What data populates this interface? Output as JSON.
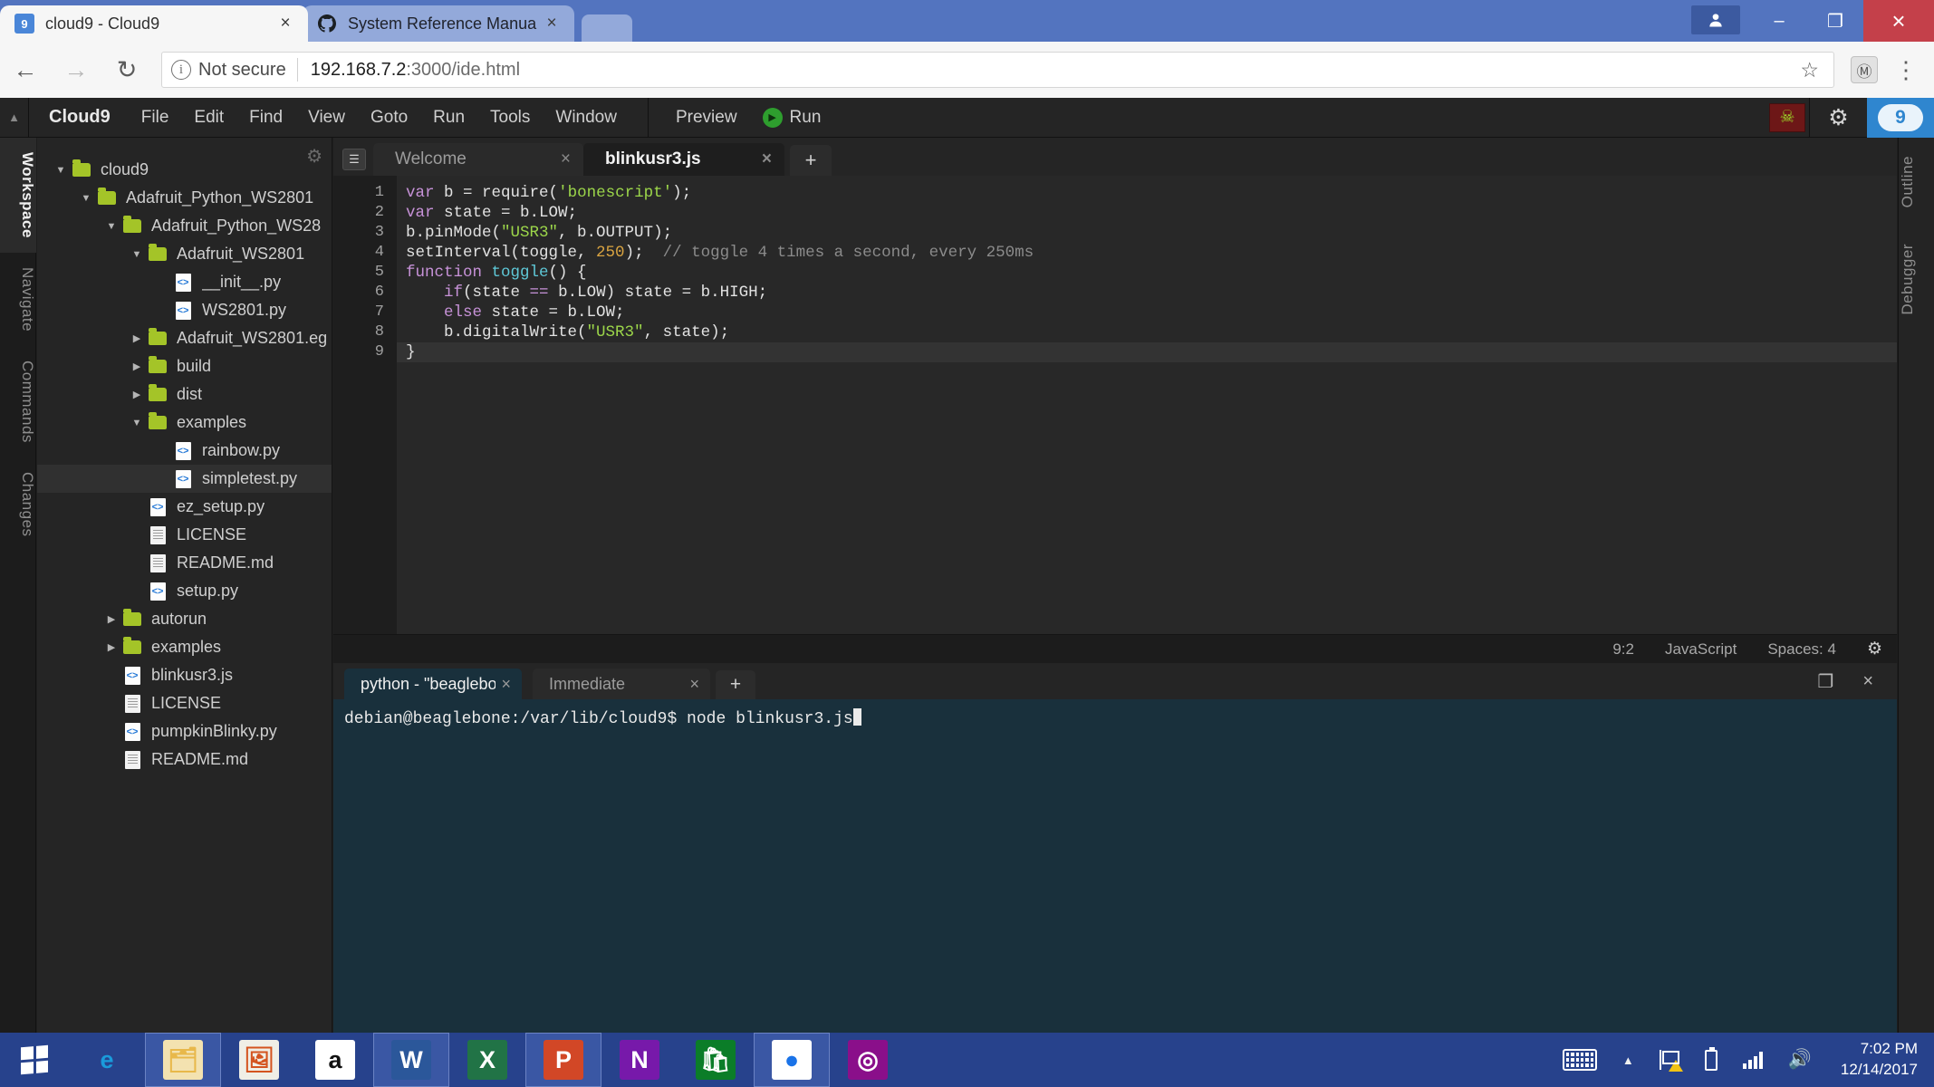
{
  "browser": {
    "tabs": [
      {
        "title": "cloud9 - Cloud9",
        "favicon": "cloud9-icon",
        "favicon_glyph": "9",
        "active": true,
        "close": "×"
      },
      {
        "title": "System Reference Manua",
        "favicon": "github-icon",
        "favicon_glyph": "●",
        "active": false,
        "close": "×"
      }
    ],
    "window_controls": {
      "profile": "👤",
      "minimize": "–",
      "restore": "❐",
      "close": "×"
    },
    "toolbar": {
      "back": "←",
      "forward": "→",
      "reload": "↻",
      "info_glyph": "i",
      "security_label": "Not secure",
      "url_host": "192.168.7.2",
      "url_rest": ":3000/ide.html",
      "bookmark": "☆",
      "extension_glyph": "Ⓜ",
      "menu": "⋮"
    }
  },
  "ide": {
    "menubar": {
      "collapse": "▲",
      "brand": "Cloud9",
      "items": [
        "File",
        "Edit",
        "Find",
        "View",
        "Goto",
        "Run",
        "Tools",
        "Window"
      ],
      "preview": "Preview",
      "run": "Run",
      "run_glyph": "▶",
      "bug_glyph": "☠",
      "gear_glyph": "⚙",
      "logo_glyph": "9"
    },
    "left_rail": [
      {
        "label": "Workspace",
        "active": true
      },
      {
        "label": "Navigate",
        "active": false
      },
      {
        "label": "Commands",
        "active": false
      },
      {
        "label": "Changes",
        "active": false
      }
    ],
    "right_rail": [
      {
        "label": "Outline"
      },
      {
        "label": "Debugger"
      }
    ],
    "filetree": {
      "gear": "⚙",
      "nodes": [
        {
          "label": "cloud9",
          "depth": 0,
          "type": "folder",
          "twist": "▼",
          "selected": false
        },
        {
          "label": "Adafruit_Python_WS2801",
          "depth": 1,
          "type": "folder",
          "twist": "▼",
          "selected": false
        },
        {
          "label": "Adafruit_Python_WS28",
          "depth": 2,
          "type": "folder",
          "twist": "▼",
          "selected": false
        },
        {
          "label": "Adafruit_WS2801",
          "depth": 3,
          "type": "folder",
          "twist": "▼",
          "selected": false
        },
        {
          "label": "__init__.py",
          "depth": 4,
          "type": "py",
          "twist": "",
          "selected": false
        },
        {
          "label": "WS2801.py",
          "depth": 4,
          "type": "py",
          "twist": "",
          "selected": false
        },
        {
          "label": "Adafruit_WS2801.eg",
          "depth": 3,
          "type": "folder",
          "twist": "▶",
          "selected": false
        },
        {
          "label": "build",
          "depth": 3,
          "type": "folder",
          "twist": "▶",
          "selected": false
        },
        {
          "label": "dist",
          "depth": 3,
          "type": "folder",
          "twist": "▶",
          "selected": false
        },
        {
          "label": "examples",
          "depth": 3,
          "type": "folder",
          "twist": "▼",
          "selected": false
        },
        {
          "label": "rainbow.py",
          "depth": 4,
          "type": "py",
          "twist": "",
          "selected": false
        },
        {
          "label": "simpletest.py",
          "depth": 4,
          "type": "py",
          "twist": "",
          "selected": true
        },
        {
          "label": "ez_setup.py",
          "depth": 3,
          "type": "py",
          "twist": "",
          "selected": false
        },
        {
          "label": "LICENSE",
          "depth": 3,
          "type": "doc",
          "twist": "",
          "selected": false
        },
        {
          "label": "README.md",
          "depth": 3,
          "type": "doc",
          "twist": "",
          "selected": false
        },
        {
          "label": "setup.py",
          "depth": 3,
          "type": "py",
          "twist": "",
          "selected": false
        },
        {
          "label": "autorun",
          "depth": 2,
          "type": "folder",
          "twist": "▶",
          "selected": false
        },
        {
          "label": "examples",
          "depth": 2,
          "type": "folder",
          "twist": "▶",
          "selected": false
        },
        {
          "label": "blinkusr3.js",
          "depth": 2,
          "type": "py",
          "twist": "",
          "selected": false
        },
        {
          "label": "LICENSE",
          "depth": 2,
          "type": "doc",
          "twist": "",
          "selected": false
        },
        {
          "label": "pumpkinBlinky.py",
          "depth": 2,
          "type": "py",
          "twist": "",
          "selected": false
        },
        {
          "label": "README.md",
          "depth": 2,
          "type": "doc",
          "twist": "",
          "selected": false
        }
      ]
    },
    "editor": {
      "tab_menu_glyph": "☰",
      "tabs": [
        {
          "label": "Welcome",
          "active": false,
          "close": "×"
        },
        {
          "label": "blinkusr3.js",
          "active": true,
          "close": "×"
        }
      ],
      "new_tab": "+",
      "line_numbers": [
        "1",
        "2",
        "3",
        "4",
        "5",
        "6",
        "7",
        "8",
        "9"
      ],
      "code_lines": [
        [
          {
            "t": "var ",
            "c": "k-kw"
          },
          {
            "t": "b = ",
            "c": "k-id"
          },
          {
            "t": "require",
            "c": "k-id"
          },
          {
            "t": "(",
            "c": "k-id"
          },
          {
            "t": "'bonescript'",
            "c": "k-str"
          },
          {
            "t": ");",
            "c": "k-id"
          }
        ],
        [
          {
            "t": "var ",
            "c": "k-kw"
          },
          {
            "t": "state = b.LOW;",
            "c": "k-id"
          }
        ],
        [
          {
            "t": "b.pinMode(",
            "c": "k-id"
          },
          {
            "t": "\"USR3\"",
            "c": "k-str"
          },
          {
            "t": ", b.OUTPUT);",
            "c": "k-id"
          }
        ],
        [
          {
            "t": "setInterval(toggle, ",
            "c": "k-id"
          },
          {
            "t": "250",
            "c": "k-num"
          },
          {
            "t": ");  ",
            "c": "k-id"
          },
          {
            "t": "// toggle 4 times a second, every 250ms",
            "c": "k-cmt"
          }
        ],
        [
          {
            "t": "function ",
            "c": "k-kw"
          },
          {
            "t": "toggle",
            "c": "k-fn"
          },
          {
            "t": "() {",
            "c": "k-id"
          }
        ],
        [
          {
            "t": "    ",
            "c": "k-id"
          },
          {
            "t": "if",
            "c": "k-kw"
          },
          {
            "t": "(state ",
            "c": "k-id"
          },
          {
            "t": "==",
            "c": "k-kw"
          },
          {
            "t": " b.LOW) state = b.HIGH;",
            "c": "k-id"
          }
        ],
        [
          {
            "t": "    ",
            "c": "k-id"
          },
          {
            "t": "else",
            "c": "k-kw"
          },
          {
            "t": " state = b.LOW;",
            "c": "k-id"
          }
        ],
        [
          {
            "t": "    b.digitalWrite(",
            "c": "k-id"
          },
          {
            "t": "\"USR3\"",
            "c": "k-str"
          },
          {
            "t": ", state);",
            "c": "k-id"
          }
        ],
        [
          {
            "t": "}",
            "c": "k-id"
          }
        ]
      ],
      "cursor_line_index": 8,
      "status": {
        "position": "9:2",
        "language": "JavaScript",
        "indent": "Spaces: 4",
        "gear": "⚙"
      }
    },
    "terminal": {
      "tabs": [
        {
          "label": "python - \"beaglebon",
          "active": true,
          "close": "×"
        },
        {
          "label": "Immediate",
          "active": false,
          "close": "×"
        }
      ],
      "new_tab": "+",
      "maximize": "❐",
      "close": "×",
      "lines": [
        "debian@beaglebone:/var/lib/cloud9$ node blinkusr3.js"
      ]
    }
  },
  "taskbar": {
    "start_label": "start-button",
    "items": [
      {
        "name": "internet-explorer",
        "glyph": "e",
        "color": "#1a9bdb",
        "bg": "transparent",
        "pinned": false
      },
      {
        "name": "file-explorer",
        "glyph": "🗂",
        "color": "#e8b84a",
        "bg": "#f3e2b0",
        "pinned": true
      },
      {
        "name": "photos",
        "glyph": "🖼",
        "color": "#d4541f",
        "bg": "#f0efe6",
        "pinned": false
      },
      {
        "name": "amazon",
        "glyph": "a",
        "color": "#111111",
        "bg": "#ffffff",
        "pinned": false
      },
      {
        "name": "microsoft-word",
        "glyph": "W",
        "color": "#ffffff",
        "bg": "#2b579a",
        "pinned": true
      },
      {
        "name": "microsoft-excel",
        "glyph": "X",
        "color": "#ffffff",
        "bg": "#217346",
        "pinned": false
      },
      {
        "name": "microsoft-powerpoint",
        "glyph": "P",
        "color": "#ffffff",
        "bg": "#d24726",
        "pinned": true
      },
      {
        "name": "microsoft-onenote",
        "glyph": "N",
        "color": "#ffffff",
        "bg": "#7719aa",
        "pinned": false
      },
      {
        "name": "microsoft-store",
        "glyph": "🛍",
        "color": "#ffffff",
        "bg": "#0b7d28",
        "pinned": false
      },
      {
        "name": "google-chrome",
        "glyph": "●",
        "color": "#1a73e8",
        "bg": "#ffffff",
        "pinned": true
      },
      {
        "name": "snip-tool",
        "glyph": "◎",
        "color": "#ffffff",
        "bg": "#8a0f8a",
        "pinned": false
      }
    ],
    "tray": {
      "keyboard": "keyboard-icon",
      "show_hidden": "▲",
      "flag": "flag-icon",
      "battery": "battery-icon",
      "network": "network-icon",
      "volume": "🔊",
      "time": "7:02 PM",
      "date": "12/14/2017"
    }
  }
}
